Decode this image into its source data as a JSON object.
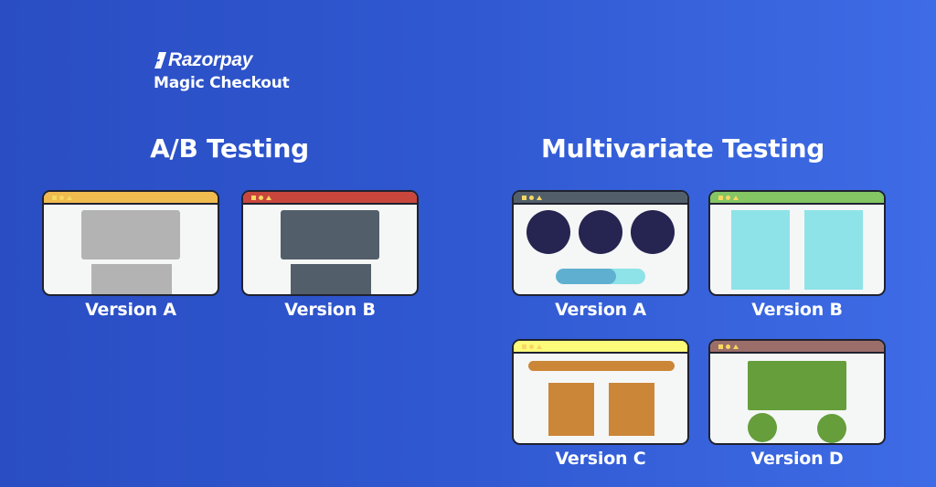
{
  "brand": {
    "name": "Razorpay",
    "product": "Magic Checkout"
  },
  "sections": {
    "ab": {
      "title": "A/B Testing",
      "versions": [
        {
          "label": "Version A",
          "titlebar_color": "#f0bb4f",
          "content_color": "#b3b3b3",
          "layout": "stacked-blocks"
        },
        {
          "label": "Version B",
          "titlebar_color": "#c9463c",
          "content_color": "#525f6b",
          "layout": "stacked-blocks"
        }
      ]
    },
    "multivariate": {
      "title": "Multivariate Testing",
      "versions": [
        {
          "label": "Version A",
          "titlebar_color": "#525f6b",
          "content_color": "#262450",
          "accent_color": "#8ee3e8",
          "fill_color": "#5fb0d0",
          "progress_fraction": 0.67,
          "layout": "three-circles-progress"
        },
        {
          "label": "Version B",
          "titlebar_color": "#84c564",
          "content_color": "#8ee3e8",
          "layout": "two-columns"
        },
        {
          "label": "Version C",
          "titlebar_color": "#fdfb7a",
          "content_color": "#cc8637",
          "layout": "banner-two-columns"
        },
        {
          "label": "Version D",
          "titlebar_color": "#9c6e6a",
          "content_color": "#659e3b",
          "layout": "block-two-circles"
        }
      ]
    }
  }
}
